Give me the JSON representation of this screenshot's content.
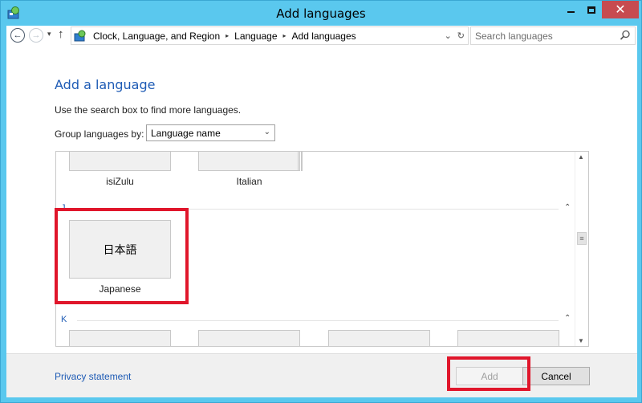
{
  "window": {
    "title": "Add languages",
    "close_glyph": "✕"
  },
  "nav": {
    "back_glyph": "←",
    "forward_glyph": "→",
    "dropdown_glyph": "▾",
    "up_glyph": "↑",
    "crumbs": [
      "Clock, Language, and Region",
      "Language",
      "Add languages"
    ],
    "crumb_separator": "▸",
    "crumb_dropdown_glyph": "⌄",
    "refresh_glyph": "↻"
  },
  "search": {
    "placeholder": "Search languages"
  },
  "main": {
    "heading": "Add a language",
    "description": "Use the search box to find more languages.",
    "group_label": "Group languages by:",
    "group_value": "Language name",
    "group_arrow": "⌄"
  },
  "languages": {
    "top_row": [
      {
        "label": "isiZulu"
      },
      {
        "label": "Italian"
      }
    ],
    "groups": [
      {
        "letter": "J",
        "collapse_glyph": "⌃"
      },
      {
        "letter": "K",
        "collapse_glyph": "⌃"
      }
    ],
    "japanese": {
      "native": "日本語",
      "label": "Japanese"
    },
    "scroll": {
      "up": "▲",
      "down": "▼",
      "thumb": "≡"
    }
  },
  "footer": {
    "privacy_label": "Privacy statement",
    "add_label": "Add",
    "cancel_label": "Cancel"
  },
  "colors": {
    "frame": "#5ac8ee",
    "link": "#1e5bb5",
    "highlight": "#e0162b",
    "close_button": "#c74b50"
  }
}
